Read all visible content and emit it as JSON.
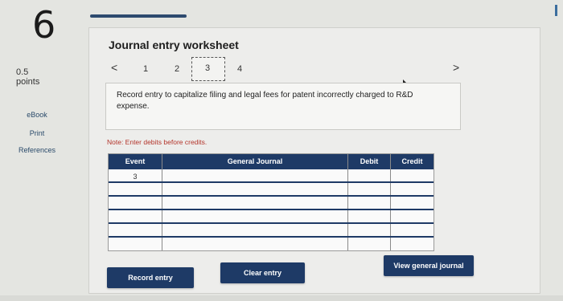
{
  "question": {
    "number": "6",
    "points_value": "0.5",
    "points_label": "points"
  },
  "sidebar": {
    "items": [
      "eBook",
      "Print",
      "References"
    ]
  },
  "worksheet": {
    "title": "Journal entry worksheet",
    "prev_arrow": "<",
    "next_arrow": ">",
    "pages": [
      "1",
      "2",
      "3",
      "4"
    ],
    "active_page": "3",
    "instruction": "Record entry to capitalize filing and legal fees for patent incorrectly charged to R&D expense.",
    "note": "Note: Enter debits before credits."
  },
  "table": {
    "headers": {
      "event": "Event",
      "journal": "General Journal",
      "debit": "Debit",
      "credit": "Credit"
    },
    "event_value": "3",
    "rows": 6
  },
  "buttons": {
    "record": "Record entry",
    "clear": "Clear entry",
    "view": "View general journal"
  },
  "colors": {
    "primary": "#1e3a66",
    "note": "#b3342a",
    "panel": "#ededeb"
  },
  "icons": [
    "chevron-left-icon",
    "chevron-right-icon",
    "cursor-icon"
  ]
}
